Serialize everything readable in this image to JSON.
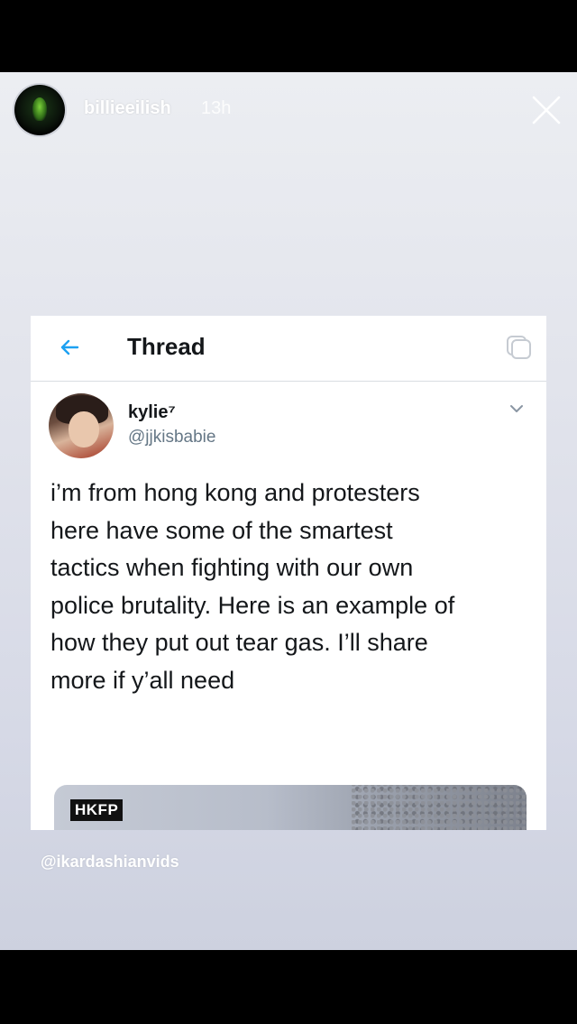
{
  "story": {
    "username": "billieeilish",
    "time_ago": "13h",
    "credit": "@ikardashianvids"
  },
  "tweet_card": {
    "header_title": "Thread",
    "author": {
      "display_name": "kylie⁷",
      "handle": "@jjkisbabie"
    },
    "text_lines": [
      "i’m from hong kong and protesters",
      "here have some of the smartest",
      "tactics when fighting with our own",
      "police brutality. Here is an example of",
      "how they put out tear gas. I’ll share",
      "more if y’all need"
    ],
    "media_badge": "HKFP"
  },
  "icons": {
    "close": "close-icon",
    "back": "back-arrow-icon",
    "copy": "copy-icon",
    "more": "chevron-down-icon"
  },
  "colors": {
    "accent": "#1da1f2",
    "text_primary": "#14171a",
    "text_secondary": "#657786"
  }
}
